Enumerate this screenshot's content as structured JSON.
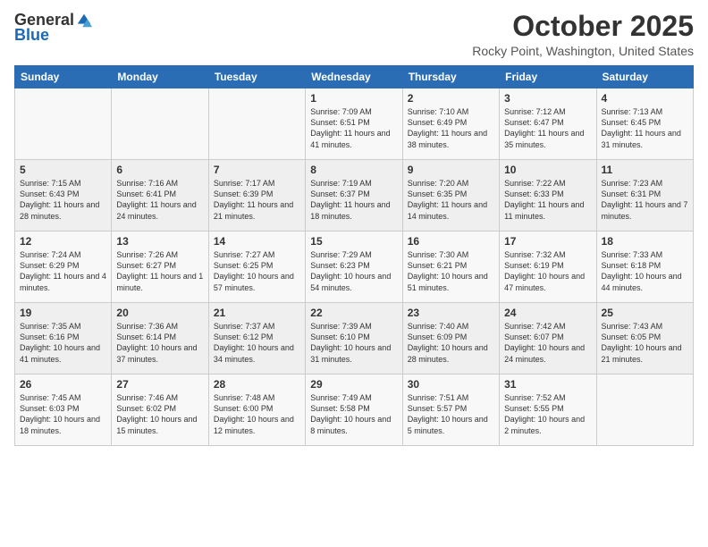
{
  "logo": {
    "general": "General",
    "blue": "Blue"
  },
  "title": "October 2025",
  "location": "Rocky Point, Washington, United States",
  "days_of_week": [
    "Sunday",
    "Monday",
    "Tuesday",
    "Wednesday",
    "Thursday",
    "Friday",
    "Saturday"
  ],
  "weeks": [
    [
      {
        "day": "",
        "sunrise": "",
        "sunset": "",
        "daylight": ""
      },
      {
        "day": "",
        "sunrise": "",
        "sunset": "",
        "daylight": ""
      },
      {
        "day": "",
        "sunrise": "",
        "sunset": "",
        "daylight": ""
      },
      {
        "day": "1",
        "sunrise": "Sunrise: 7:09 AM",
        "sunset": "Sunset: 6:51 PM",
        "daylight": "Daylight: 11 hours and 41 minutes."
      },
      {
        "day": "2",
        "sunrise": "Sunrise: 7:10 AM",
        "sunset": "Sunset: 6:49 PM",
        "daylight": "Daylight: 11 hours and 38 minutes."
      },
      {
        "day": "3",
        "sunrise": "Sunrise: 7:12 AM",
        "sunset": "Sunset: 6:47 PM",
        "daylight": "Daylight: 11 hours and 35 minutes."
      },
      {
        "day": "4",
        "sunrise": "Sunrise: 7:13 AM",
        "sunset": "Sunset: 6:45 PM",
        "daylight": "Daylight: 11 hours and 31 minutes."
      }
    ],
    [
      {
        "day": "5",
        "sunrise": "Sunrise: 7:15 AM",
        "sunset": "Sunset: 6:43 PM",
        "daylight": "Daylight: 11 hours and 28 minutes."
      },
      {
        "day": "6",
        "sunrise": "Sunrise: 7:16 AM",
        "sunset": "Sunset: 6:41 PM",
        "daylight": "Daylight: 11 hours and 24 minutes."
      },
      {
        "day": "7",
        "sunrise": "Sunrise: 7:17 AM",
        "sunset": "Sunset: 6:39 PM",
        "daylight": "Daylight: 11 hours and 21 minutes."
      },
      {
        "day": "8",
        "sunrise": "Sunrise: 7:19 AM",
        "sunset": "Sunset: 6:37 PM",
        "daylight": "Daylight: 11 hours and 18 minutes."
      },
      {
        "day": "9",
        "sunrise": "Sunrise: 7:20 AM",
        "sunset": "Sunset: 6:35 PM",
        "daylight": "Daylight: 11 hours and 14 minutes."
      },
      {
        "day": "10",
        "sunrise": "Sunrise: 7:22 AM",
        "sunset": "Sunset: 6:33 PM",
        "daylight": "Daylight: 11 hours and 11 minutes."
      },
      {
        "day": "11",
        "sunrise": "Sunrise: 7:23 AM",
        "sunset": "Sunset: 6:31 PM",
        "daylight": "Daylight: 11 hours and 7 minutes."
      }
    ],
    [
      {
        "day": "12",
        "sunrise": "Sunrise: 7:24 AM",
        "sunset": "Sunset: 6:29 PM",
        "daylight": "Daylight: 11 hours and 4 minutes."
      },
      {
        "day": "13",
        "sunrise": "Sunrise: 7:26 AM",
        "sunset": "Sunset: 6:27 PM",
        "daylight": "Daylight: 11 hours and 1 minute."
      },
      {
        "day": "14",
        "sunrise": "Sunrise: 7:27 AM",
        "sunset": "Sunset: 6:25 PM",
        "daylight": "Daylight: 10 hours and 57 minutes."
      },
      {
        "day": "15",
        "sunrise": "Sunrise: 7:29 AM",
        "sunset": "Sunset: 6:23 PM",
        "daylight": "Daylight: 10 hours and 54 minutes."
      },
      {
        "day": "16",
        "sunrise": "Sunrise: 7:30 AM",
        "sunset": "Sunset: 6:21 PM",
        "daylight": "Daylight: 10 hours and 51 minutes."
      },
      {
        "day": "17",
        "sunrise": "Sunrise: 7:32 AM",
        "sunset": "Sunset: 6:19 PM",
        "daylight": "Daylight: 10 hours and 47 minutes."
      },
      {
        "day": "18",
        "sunrise": "Sunrise: 7:33 AM",
        "sunset": "Sunset: 6:18 PM",
        "daylight": "Daylight: 10 hours and 44 minutes."
      }
    ],
    [
      {
        "day": "19",
        "sunrise": "Sunrise: 7:35 AM",
        "sunset": "Sunset: 6:16 PM",
        "daylight": "Daylight: 10 hours and 41 minutes."
      },
      {
        "day": "20",
        "sunrise": "Sunrise: 7:36 AM",
        "sunset": "Sunset: 6:14 PM",
        "daylight": "Daylight: 10 hours and 37 minutes."
      },
      {
        "day": "21",
        "sunrise": "Sunrise: 7:37 AM",
        "sunset": "Sunset: 6:12 PM",
        "daylight": "Daylight: 10 hours and 34 minutes."
      },
      {
        "day": "22",
        "sunrise": "Sunrise: 7:39 AM",
        "sunset": "Sunset: 6:10 PM",
        "daylight": "Daylight: 10 hours and 31 minutes."
      },
      {
        "day": "23",
        "sunrise": "Sunrise: 7:40 AM",
        "sunset": "Sunset: 6:09 PM",
        "daylight": "Daylight: 10 hours and 28 minutes."
      },
      {
        "day": "24",
        "sunrise": "Sunrise: 7:42 AM",
        "sunset": "Sunset: 6:07 PM",
        "daylight": "Daylight: 10 hours and 24 minutes."
      },
      {
        "day": "25",
        "sunrise": "Sunrise: 7:43 AM",
        "sunset": "Sunset: 6:05 PM",
        "daylight": "Daylight: 10 hours and 21 minutes."
      }
    ],
    [
      {
        "day": "26",
        "sunrise": "Sunrise: 7:45 AM",
        "sunset": "Sunset: 6:03 PM",
        "daylight": "Daylight: 10 hours and 18 minutes."
      },
      {
        "day": "27",
        "sunrise": "Sunrise: 7:46 AM",
        "sunset": "Sunset: 6:02 PM",
        "daylight": "Daylight: 10 hours and 15 minutes."
      },
      {
        "day": "28",
        "sunrise": "Sunrise: 7:48 AM",
        "sunset": "Sunset: 6:00 PM",
        "daylight": "Daylight: 10 hours and 12 minutes."
      },
      {
        "day": "29",
        "sunrise": "Sunrise: 7:49 AM",
        "sunset": "Sunset: 5:58 PM",
        "daylight": "Daylight: 10 hours and 8 minutes."
      },
      {
        "day": "30",
        "sunrise": "Sunrise: 7:51 AM",
        "sunset": "Sunset: 5:57 PM",
        "daylight": "Daylight: 10 hours and 5 minutes."
      },
      {
        "day": "31",
        "sunrise": "Sunrise: 7:52 AM",
        "sunset": "Sunset: 5:55 PM",
        "daylight": "Daylight: 10 hours and 2 minutes."
      },
      {
        "day": "",
        "sunrise": "",
        "sunset": "",
        "daylight": ""
      }
    ]
  ]
}
